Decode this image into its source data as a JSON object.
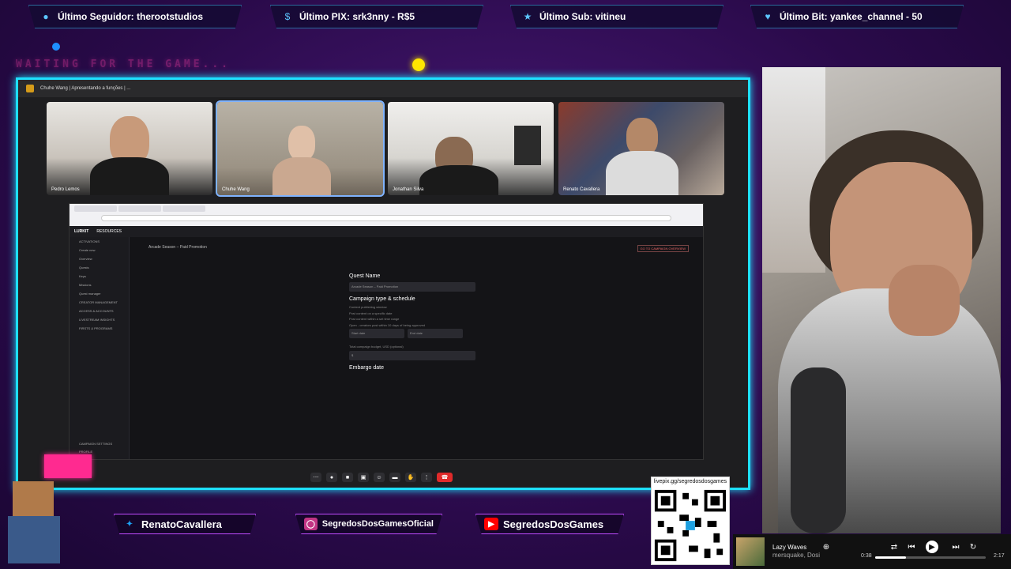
{
  "topbar": {
    "items": [
      {
        "icon": "user-icon",
        "label": "Último Seguidor: therootstudios"
      },
      {
        "icon": "dollar-icon",
        "label": "Último PIX: srk3nny - R$5"
      },
      {
        "icon": "star-icon",
        "label": "Último Sub: vitineu"
      },
      {
        "icon": "heart-icon",
        "label": "Último Bit: yankee_channel - 50"
      }
    ]
  },
  "overlay": {
    "waiting": "WAITING FOR THE GAME..."
  },
  "meeting": {
    "title": "Chuhe Wang | Apresentando a funções | ...",
    "participants": [
      {
        "name": "Pedro Lemos"
      },
      {
        "name": "Chuhe Wang"
      },
      {
        "name": "Jonathan Silva"
      },
      {
        "name": "Renato Cavallera"
      }
    ]
  },
  "shared_screen": {
    "app_name": "LURKIT",
    "nav_resources": "RESOURCES",
    "sidebar": [
      "ACTIVATIONS",
      "Create new",
      "Overview",
      "Quests",
      "Keys",
      "Missions",
      "Quest manager",
      "CREATOR MANAGEMENT",
      "ACCESS & ACCOUNTS",
      "LIVESTREAM INSIGHTS",
      "FIRSTS & PROGRAMS",
      "CAMPAIGN SETTINGS",
      "PROFILE"
    ],
    "breadcrumb": "Arcade Season – Paid Promotion",
    "form": {
      "quest_name_label": "Quest Name",
      "quest_name_value": "Arcade Season – Paid Promotion",
      "campaign_type_label": "Campaign type & schedule",
      "publishing_label": "Content publishing window",
      "option_1": "Post content on a specific date",
      "option_2": "Post content within a set time range",
      "option_3": "Open - creators post within 10 days of being approved",
      "start_label": "Start date",
      "end_label": "End date",
      "budget_label": "Total campaign budget, USD (optional)",
      "budget_value": "$",
      "embargo_label": "Embargo date"
    },
    "top_button": "GO TO CAMPAIGN OVERVIEW"
  },
  "socials": [
    {
      "icon": "twitter-icon",
      "label": "RenatoCavallera",
      "color": "#1da1f2"
    },
    {
      "icon": "instagram-icon",
      "label": "SegredosDosGamesOficial",
      "color": "#c13584"
    },
    {
      "icon": "youtube-icon",
      "label": "SegredosDosGames",
      "color": "#ff0000"
    }
  ],
  "qr": {
    "caption": "livepix.gg/segredosdosgames"
  },
  "player": {
    "title": "Lazy Waves",
    "artist": "mersquake, Dosi",
    "time_current": "0:38",
    "time_total": "2:17",
    "progress": 0.28
  }
}
